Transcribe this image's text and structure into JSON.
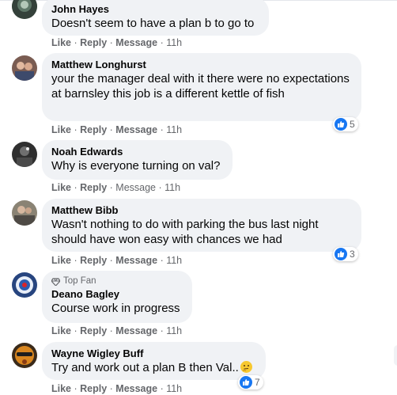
{
  "comments": [
    {
      "author": "John Hayes",
      "text": "Doesn't seem to have a plan b to go to",
      "like": "Like",
      "reply": "Reply",
      "message": "Message",
      "time": "11h",
      "avatar_color": "#3a4a3a"
    },
    {
      "author": "Matthew Longhurst",
      "text": "your the manager deal with it there were no expectations at barnsley this job is a different kettle of fish",
      "like": "Like",
      "reply": "Reply",
      "message": "Message",
      "time": "11h",
      "reactions": "5",
      "avatar_color": "#8b6a5a"
    },
    {
      "author": "Noah Edwards",
      "text": "Why is everyone turning on val?",
      "like": "Like",
      "reply": "Reply",
      "message": "Message",
      "time": "11h",
      "avatar_color": "#3c3c3c"
    },
    {
      "author": "Matthew Bibb",
      "text": "Wasn't nothing to do with parking the bus last night should have won easy with chances we had",
      "like": "Like",
      "reply": "Reply",
      "message": "Message",
      "time": "11h",
      "reactions": "3",
      "avatar_color": "#6d6658"
    },
    {
      "badge": "Top Fan",
      "author": "Deano Bagley",
      "text": "Course work in progress",
      "like": "Like",
      "reply": "Reply",
      "message": "Message",
      "time": "11h",
      "avatar_color": "#2c4a8c"
    },
    {
      "author": "Wayne Wigley Buff",
      "text": "Try and work out a plan B then Val..",
      "like": "Like",
      "reply": "Reply",
      "message": "Message",
      "time": "11h",
      "reactions": "7",
      "avatar_color": "#c8781e"
    }
  ],
  "colors": {
    "bubble_bg": "#f0f2f5",
    "like_blue": "#1877f2",
    "meta_gray": "#65676b"
  },
  "icons": {
    "reaction": "thumbs-up-icon",
    "badge": "diamond-icon",
    "emoji": "thinking-face-icon"
  }
}
